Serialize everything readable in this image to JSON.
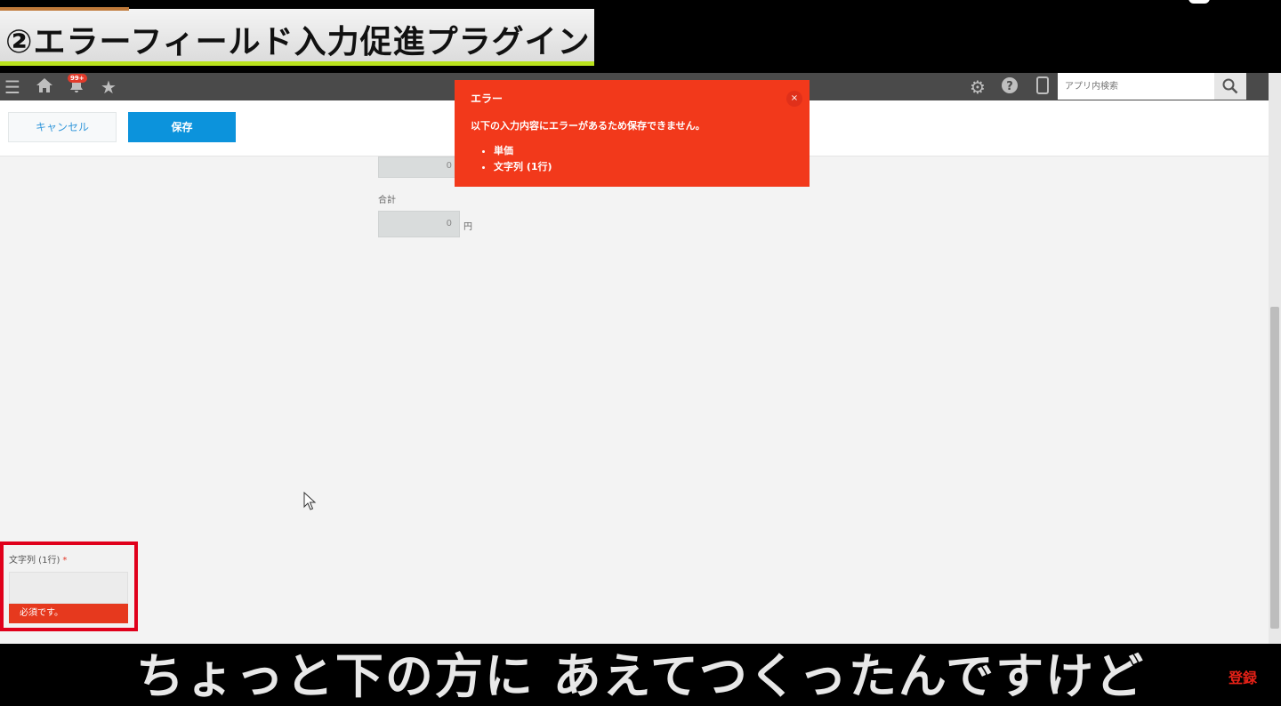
{
  "video": {
    "title": "②エラーフィールド入力促進プラグイン",
    "subtitle": "ちょっと下の方に あえてつくったんですけど",
    "subscribe_label": "登録"
  },
  "topbar": {
    "notification_badge": "99+",
    "search_placeholder": "アプリ内検索"
  },
  "actionbar": {
    "cancel_label": "キャンセル",
    "save_label": "保存"
  },
  "form": {
    "first_field_value": "0",
    "total_label": "合計",
    "total_value": "0",
    "total_unit": "円"
  },
  "error_popup": {
    "title": "エラー",
    "message": "以下の入力内容にエラーがあるため保存できません。",
    "items": [
      "単価",
      "文字列 (1行)"
    ],
    "close_glyph": "×"
  },
  "highlight_field": {
    "label": "文字列 (1行)",
    "required_mark": "*",
    "error_text": "必須です。"
  }
}
